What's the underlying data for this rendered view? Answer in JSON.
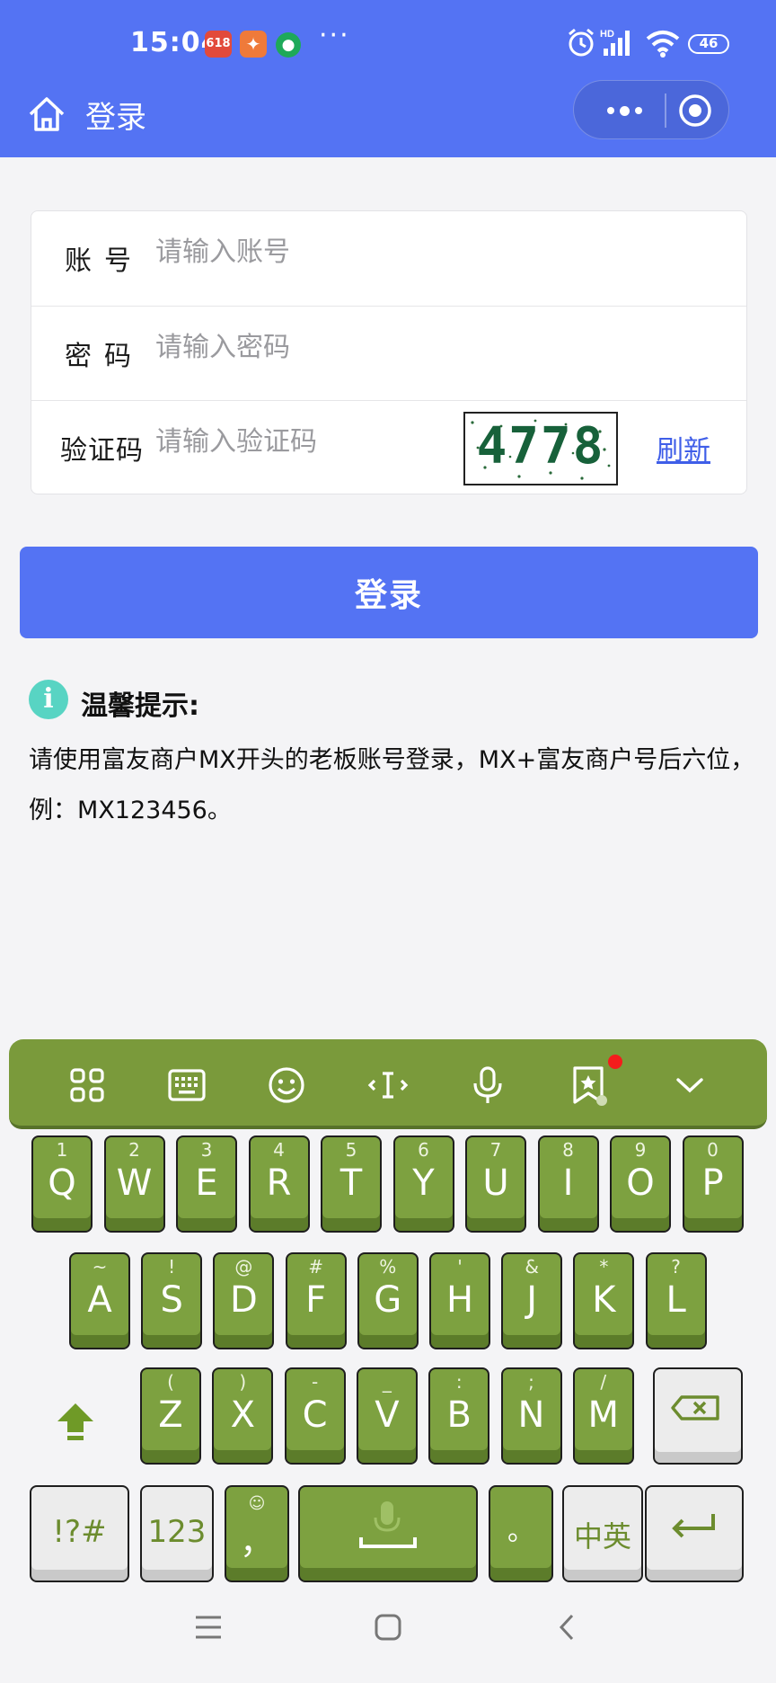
{
  "status_bar": {
    "time": "15:04",
    "notification_badge": "618",
    "battery_level": "46"
  },
  "title_bar": {
    "title": "登录"
  },
  "form": {
    "account": {
      "label": "账号",
      "placeholder": "请输入账号",
      "value": ""
    },
    "password": {
      "label": "密码",
      "placeholder": "请输入密码",
      "value": ""
    },
    "captcha": {
      "label": "验证码",
      "placeholder": "请输入验证码",
      "value": "",
      "image_text": "4778",
      "refresh_label": "刷新"
    }
  },
  "login_button": {
    "label": "登录"
  },
  "tips": {
    "title": "温馨提示:",
    "text": "请使用富友商户MX开头的老板账号登录，MX+富友商户号后六位，例：MX123456。"
  },
  "keyboard": {
    "toolbar_icons": [
      "apps-grid-icon",
      "keyboard-icon",
      "emoji-icon",
      "cursor-icon",
      "microphone-icon",
      "bookmark-star-icon",
      "collapse-chevron-icon"
    ],
    "row1": [
      {
        "sub": "1",
        "main": "Q"
      },
      {
        "sub": "2",
        "main": "W"
      },
      {
        "sub": "3",
        "main": "E"
      },
      {
        "sub": "4",
        "main": "R"
      },
      {
        "sub": "5",
        "main": "T"
      },
      {
        "sub": "6",
        "main": "Y"
      },
      {
        "sub": "7",
        "main": "U"
      },
      {
        "sub": "8",
        "main": "I"
      },
      {
        "sub": "9",
        "main": "O"
      },
      {
        "sub": "0",
        "main": "P"
      }
    ],
    "row2": [
      {
        "sub": "~",
        "main": "A"
      },
      {
        "sub": "!",
        "main": "S"
      },
      {
        "sub": "@",
        "main": "D"
      },
      {
        "sub": "#",
        "main": "F"
      },
      {
        "sub": "%",
        "main": "G"
      },
      {
        "sub": "'",
        "main": "H"
      },
      {
        "sub": "&",
        "main": "J"
      },
      {
        "sub": "*",
        "main": "K"
      },
      {
        "sub": "?",
        "main": "L"
      }
    ],
    "row3": [
      {
        "sub": "(",
        "main": "Z"
      },
      {
        "sub": ")",
        "main": "X"
      },
      {
        "sub": "-",
        "main": "C"
      },
      {
        "sub": "_",
        "main": "V"
      },
      {
        "sub": ":",
        "main": "B"
      },
      {
        "sub": ";",
        "main": "N"
      },
      {
        "sub": "/",
        "main": "M"
      }
    ],
    "row4": {
      "symbols": "!?#",
      "numbers": "123",
      "comma": "，",
      "period": "。",
      "lang": "中英"
    },
    "colors": {
      "key": "#7da140",
      "toolbar": "#7a9a3b",
      "accent": "#5473f3"
    }
  },
  "nav_bar": {
    "icons": [
      "menu-icon",
      "home-square-icon",
      "back-icon"
    ]
  }
}
